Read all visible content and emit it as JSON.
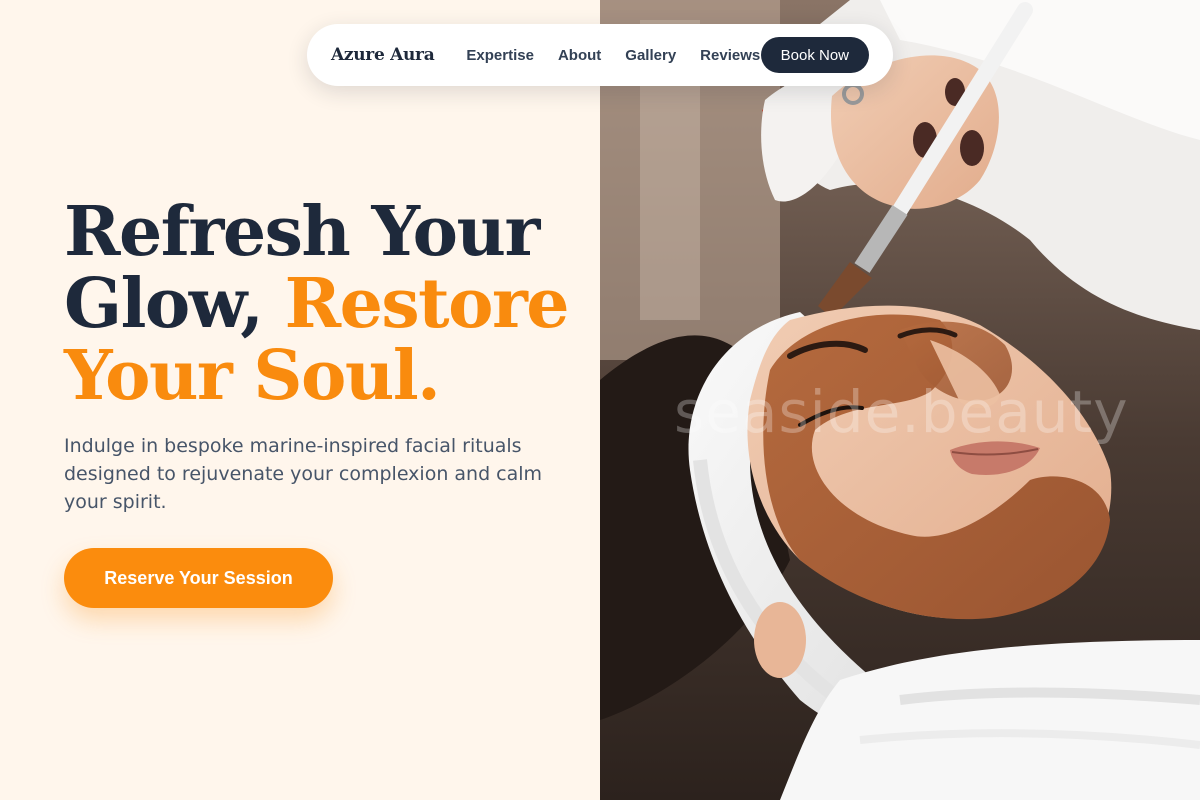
{
  "brand": {
    "name": "Azure Aura"
  },
  "nav": {
    "links": [
      {
        "label": "Expertise"
      },
      {
        "label": "About"
      },
      {
        "label": "Gallery"
      },
      {
        "label": "Reviews"
      }
    ],
    "cta_label": "Book Now"
  },
  "hero": {
    "headline_line1": "Refresh Your",
    "headline_line2_plain": "Glow,",
    "headline_line2_accent": "Restore",
    "headline_line3_accent": "Your Soul.",
    "subtext": "Indulge in bespoke marine-inspired facial rituals designed to rejuvenate your complexion and calm your spirit.",
    "cta_label": "Reserve Your Session"
  },
  "image": {
    "subject": "woman receiving clay facial mask applied with brush",
    "watermark_text": "seaside.beauty"
  },
  "colors": {
    "background": "#FFF6EC",
    "dark_navy": "#1E293B",
    "accent_orange": "#F98B0E",
    "body_text": "#475569"
  }
}
